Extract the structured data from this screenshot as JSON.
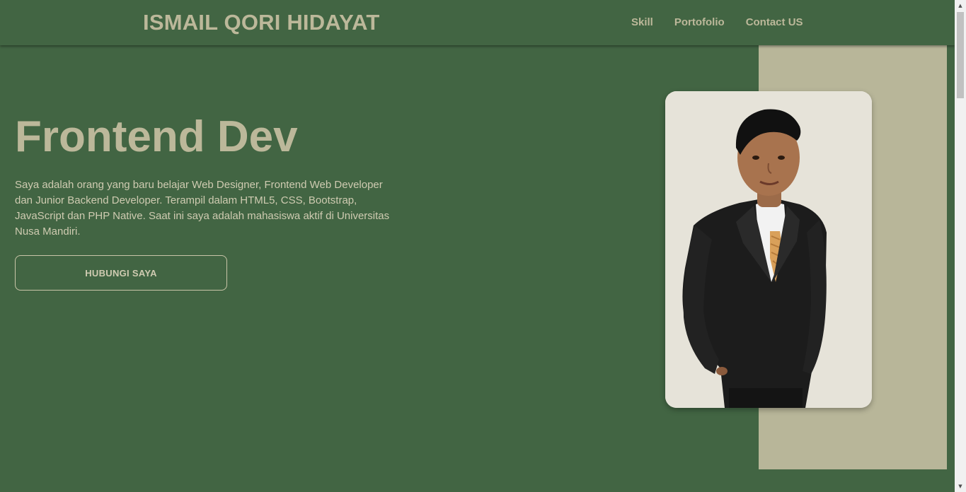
{
  "navbar": {
    "brand": "ISMAIL QORI HIDAYAT",
    "links": [
      "Skill",
      "Portofolio",
      "Contact US"
    ]
  },
  "hero": {
    "title": "Frontend Dev",
    "description": "Saya adalah orang yang baru belajar Web Designer, Frontend Web Developer dan Junior Backend Developer. Terampil dalam HTML5, CSS, Bootstrap, JavaScript dan PHP Native. Saat ini saya adalah mahasiswa aktif di Universitas Nusa Mandiri.",
    "cta_label": "HUBUNGI SAYA"
  },
  "colors": {
    "background": "#426543",
    "accent_panel": "#b8b699",
    "text": "#bcb89a"
  },
  "icons": {
    "scroll_up": "scroll-up-arrow-icon",
    "scroll_down": "scroll-down-arrow-icon"
  }
}
